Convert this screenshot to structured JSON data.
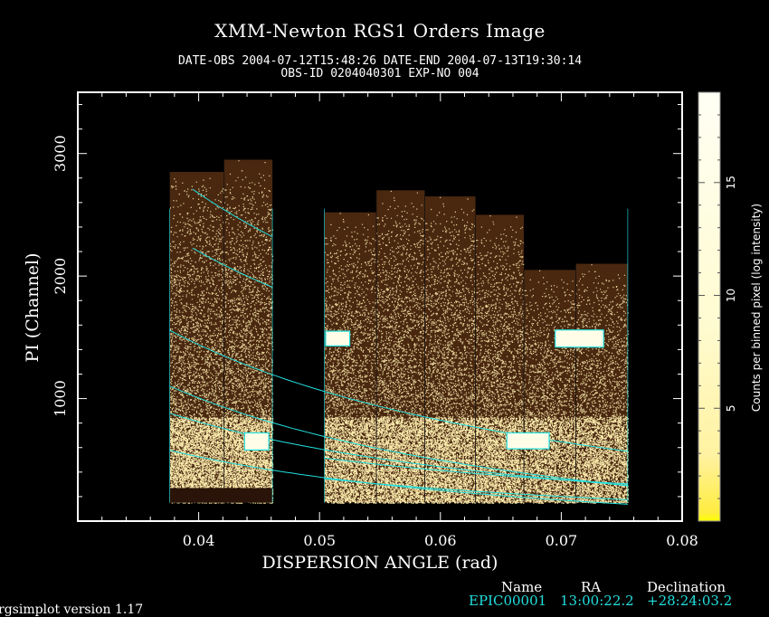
{
  "header": {
    "title": "XMM-Newton  RGS1 Orders Image",
    "line1": "DATE-OBS 2004-07-12T15:48:26   DATE-END 2004-07-13T19:30:14",
    "line2": "OBS-ID 0204040301 EXP-NO 004"
  },
  "chart_data": {
    "type": "heatmap",
    "xlabel": "DISPERSION ANGLE (rad)",
    "ylabel": "PI (Channel)",
    "xlim": [
      0.03,
      0.08
    ],
    "ylim": [
      0,
      3500
    ],
    "x_ticks": [
      0.04,
      0.05,
      0.06,
      0.07,
      0.08
    ],
    "x_tick_labels": [
      "0.04",
      "0.05",
      "0.06",
      "0.07",
      "0.08"
    ],
    "y_ticks": [
      1000,
      2000,
      3000
    ],
    "y_tick_labels": [
      "1000",
      "2000",
      "3000"
    ],
    "colorbar": {
      "label": "Counts per binned pixel (log intensity)",
      "range": [
        0,
        19
      ],
      "ticks": [
        5,
        10,
        15
      ],
      "tick_labels": [
        "5",
        "10",
        "15"
      ],
      "colormap": [
        "#fffff4",
        "#fffbd0",
        "#fff2a0",
        "#ffec40",
        "#ffff00"
      ]
    },
    "colors": {
      "background": "#000000",
      "data_dark": "#4a2810",
      "data_light": "#fff0b0",
      "region": "#22dede"
    },
    "ccd_segments": [
      {
        "x": [
          0.0376,
          0.0421
        ],
        "pi_max": 2850
      },
      {
        "x": [
          0.0421,
          0.0461
        ],
        "pi_max": 2950
      },
      {
        "x": [
          0.0504,
          0.0547
        ],
        "pi_max": 2520
      },
      {
        "x": [
          0.0547,
          0.0587
        ],
        "pi_max": 2700
      },
      {
        "x": [
          0.0587,
          0.0629
        ],
        "pi_max": 2650
      },
      {
        "x": [
          0.0629,
          0.0669
        ],
        "pi_max": 2500
      },
      {
        "x": [
          0.0669,
          0.0712
        ],
        "pi_max": 2050
      },
      {
        "x": [
          0.0712,
          0.0755
        ],
        "pi_max": 2100
      }
    ],
    "source_boxes": [
      {
        "x": [
          0.0505,
          0.0525
        ],
        "pi": [
          1430,
          1550
        ]
      },
      {
        "x": [
          0.0695,
          0.0735
        ],
        "pi": [
          1420,
          1560
        ]
      },
      {
        "x": [
          0.0438,
          0.0458
        ],
        "pi": [
          580,
          720
        ]
      },
      {
        "x": [
          0.0655,
          0.069
        ],
        "pi": [
          590,
          720
        ]
      }
    ]
  },
  "source_info": {
    "headers": [
      "Name",
      "RA",
      "Declination"
    ],
    "name": "EPIC00001",
    "ra": "13:00:22.2",
    "dec": "+28:24:03.2"
  },
  "footer": {
    "version": "rgsimplot version 1.17"
  }
}
